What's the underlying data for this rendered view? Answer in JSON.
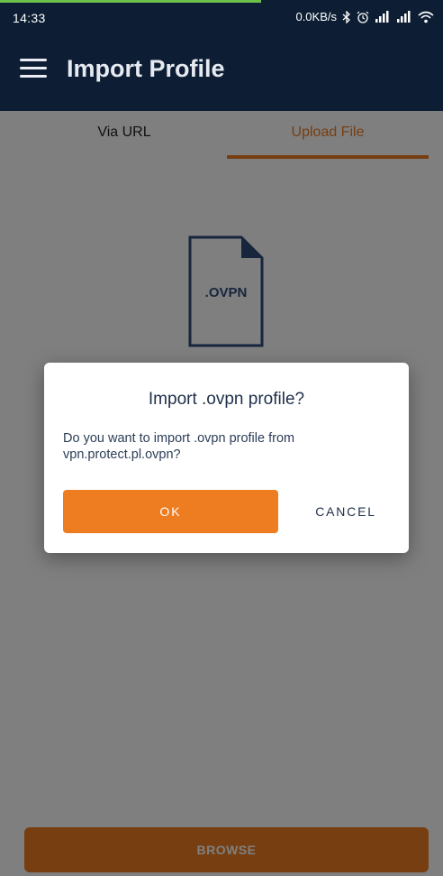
{
  "status_bar": {
    "time": "14:33",
    "network_speed": "0.0KB/s",
    "icons": [
      "bluetooth-icon",
      "alarm-icon",
      "signal-icon",
      "signal-icon",
      "wifi-icon"
    ]
  },
  "app_bar": {
    "title": "Import Profile",
    "menu_icon": "hamburger-menu-icon"
  },
  "tabs": [
    {
      "label": "Via URL",
      "selected": false
    },
    {
      "label": "Upload File",
      "selected": true
    }
  ],
  "file_icon": {
    "label": ".OVPN"
  },
  "browse_button": {
    "label": "BROWSE"
  },
  "dialog": {
    "title": "Import .ovpn profile?",
    "message": "Do you want to import .ovpn profile from vpn.protect.pl.ovpn?",
    "ok_label": "OK",
    "cancel_label": "CANCEL"
  },
  "colors": {
    "primary_dark": "#0d1e34",
    "accent": "#ee7d22",
    "file_icon": "#2f4c7a"
  }
}
